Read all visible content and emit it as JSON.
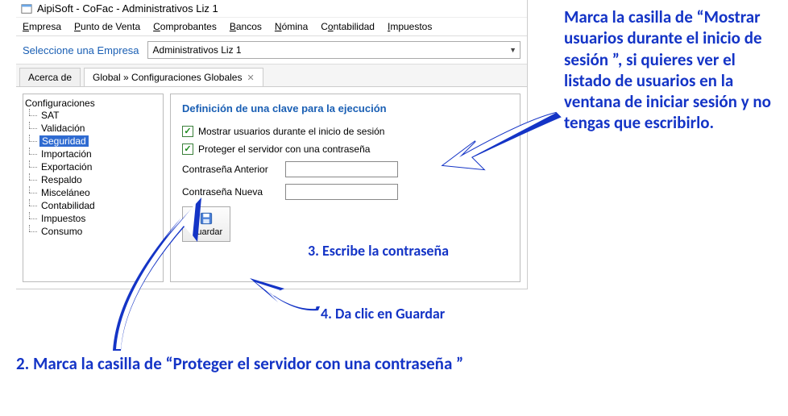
{
  "window_title": "AipiSoft - CoFac - Administrativos Liz 1",
  "menu": {
    "empresa": "Empresa",
    "punto_venta": "Punto de Venta",
    "comprobantes": "Comprobantes",
    "bancos": "Bancos",
    "nomina": "Nómina",
    "contabilidad": "Contabilidad",
    "impuestos": "Impuestos"
  },
  "company_selector": {
    "label": "Seleccione una Empresa",
    "value": "Administrativos Liz 1"
  },
  "tabs": {
    "acerca": "Acerca de",
    "global": "Global » Configuraciones Globales"
  },
  "tree": {
    "root": "Configuraciones",
    "items": [
      "SAT",
      "Validación",
      "Seguridad",
      "Importación",
      "Exportación",
      "Respaldo",
      "Misceláneo",
      "Contabilidad",
      "Impuestos",
      "Consumo"
    ],
    "selected_index": 2
  },
  "form": {
    "heading": "Definición de una clave para la ejecución",
    "chk_show_users": "Mostrar usuarios durante el inicio de sesión",
    "chk_protect": "Proteger el servidor con una contraseña",
    "lbl_old_pw": "Contraseña Anterior",
    "lbl_new_pw": "Contraseña Nueva",
    "btn_save": "Guardar"
  },
  "annotations": {
    "right_note": "Marca la casilla de  “Mostrar usuarios durante el inicio de sesión ”, si quieres ver el listado de usuarios en la ventana de  iniciar sesión y no tengas que escribirlo.",
    "step2": "2.  Marca la casilla de “Proteger el servidor con una contraseña ”",
    "step3": "3. Escribe la contraseña",
    "step4": "4. Da clic en Guardar"
  }
}
